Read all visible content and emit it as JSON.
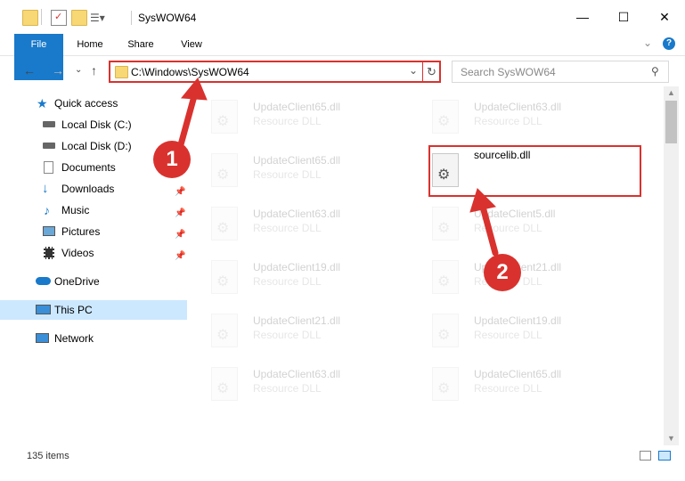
{
  "window": {
    "title": "SysWOW64",
    "controls": {
      "minimize": "—",
      "maximize": "☐",
      "close": "✕"
    }
  },
  "ribbon": {
    "tabs": [
      "File",
      "Home",
      "Share",
      "View"
    ],
    "expand_icon": "chevron-down-icon",
    "help_icon": "help-icon"
  },
  "address": {
    "path": "C:\\Windows\\SysWOW64",
    "search_placeholder": "Search SysWOW64"
  },
  "nav": {
    "items": [
      {
        "label": "Quick access",
        "icon": "star-icon"
      },
      {
        "label": "Local Disk (C:)",
        "icon": "drive-icon"
      },
      {
        "label": "Local Disk (D:)",
        "icon": "drive-icon"
      },
      {
        "label": "Documents",
        "icon": "documents-icon"
      },
      {
        "label": "Downloads",
        "icon": "download-icon",
        "pinned": true
      },
      {
        "label": "Music",
        "icon": "music-icon",
        "pinned": true
      },
      {
        "label": "Pictures",
        "icon": "pictures-icon",
        "pinned": true
      },
      {
        "label": "Videos",
        "icon": "videos-icon",
        "pinned": true
      },
      {
        "label": "OneDrive",
        "icon": "cloud-icon"
      },
      {
        "label": "This PC",
        "icon": "pc-icon",
        "selected": true
      },
      {
        "label": "Network",
        "icon": "network-icon"
      }
    ]
  },
  "files": [
    {
      "name": "UpdateClient65.dll",
      "type": "Resource DLL",
      "faded": true
    },
    {
      "name": "UpdateClient63.dll",
      "type": "Resource DLL",
      "faded": true
    },
    {
      "name": "UpdateClient65.dll",
      "type": "Resource DLL",
      "faded": true
    },
    {
      "name": "sourcelib.dll",
      "type": "",
      "faded": false,
      "highlighted": true
    },
    {
      "name": "UpdateClient63.dll",
      "type": "Resource DLL",
      "faded": true
    },
    {
      "name": "UpdateClient5.dll",
      "type": "Resource DLL",
      "faded": true
    },
    {
      "name": "UpdateClient19.dll",
      "type": "Resource DLL",
      "faded": true
    },
    {
      "name": "UpdateClient21.dll",
      "type": "Resource DLL",
      "faded": true
    },
    {
      "name": "UpdateClient21.dll",
      "type": "Resource DLL",
      "faded": true
    },
    {
      "name": "UpdateClient19.dll",
      "type": "Resource DLL",
      "faded": true
    },
    {
      "name": "UpdateClient63.dll",
      "type": "Resource DLL",
      "faded": true
    },
    {
      "name": "UpdateClient65.dll",
      "type": "Resource DLL",
      "faded": true
    }
  ],
  "status": {
    "item_count": "135 items"
  },
  "callouts": [
    "1",
    "2"
  ],
  "colors": {
    "accent": "#1979ca",
    "highlight_red": "#d9322e",
    "selected_nav": "#cce8ff"
  }
}
